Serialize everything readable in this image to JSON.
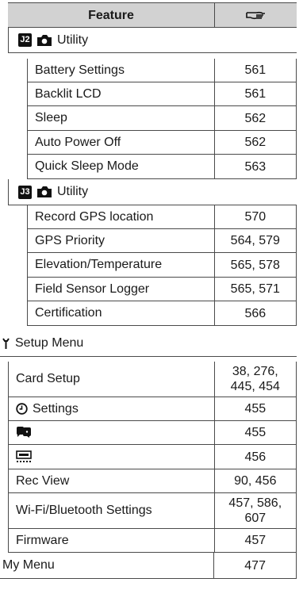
{
  "header": {
    "feature": "Feature",
    "page_icon": "page-reference-hand-icon"
  },
  "utility2": {
    "badge": "J2",
    "title": "Utility",
    "rows": [
      {
        "name": "Battery Settings",
        "page": "561"
      },
      {
        "name": "Backlit LCD",
        "page": "561"
      },
      {
        "name": "Sleep",
        "page": "562"
      },
      {
        "name": "Auto Power Off",
        "page": "562"
      },
      {
        "name": "Quick Sleep Mode",
        "page": "563"
      }
    ]
  },
  "utility3": {
    "badge": "J3",
    "title": "Utility",
    "rows": [
      {
        "name": "Record GPS location",
        "page": "570"
      },
      {
        "name": "GPS Priority",
        "page": "564, 579"
      },
      {
        "name": "Elevation/Temperature",
        "page": "565, 578"
      },
      {
        "name": "Field Sensor Logger",
        "page": "565, 571"
      },
      {
        "name": "Certification",
        "page": "566"
      }
    ]
  },
  "setup": {
    "title": "Setup Menu",
    "rows": [
      {
        "name": "Card Setup",
        "page_lines": [
          "38, 276,",
          "445, 454"
        ]
      },
      {
        "name": "Settings",
        "page": "455"
      },
      {
        "name": "",
        "page": "455"
      },
      {
        "name": "",
        "page": "456"
      },
      {
        "name": "Rec View",
        "page": "90, 456"
      },
      {
        "name": "Wi-Fi/Bluetooth Settings",
        "page_lines": [
          "457, 586,",
          "607"
        ]
      },
      {
        "name": "Firmware",
        "page": "457"
      }
    ]
  },
  "mymenu": {
    "name": "My Menu",
    "page": "477"
  }
}
